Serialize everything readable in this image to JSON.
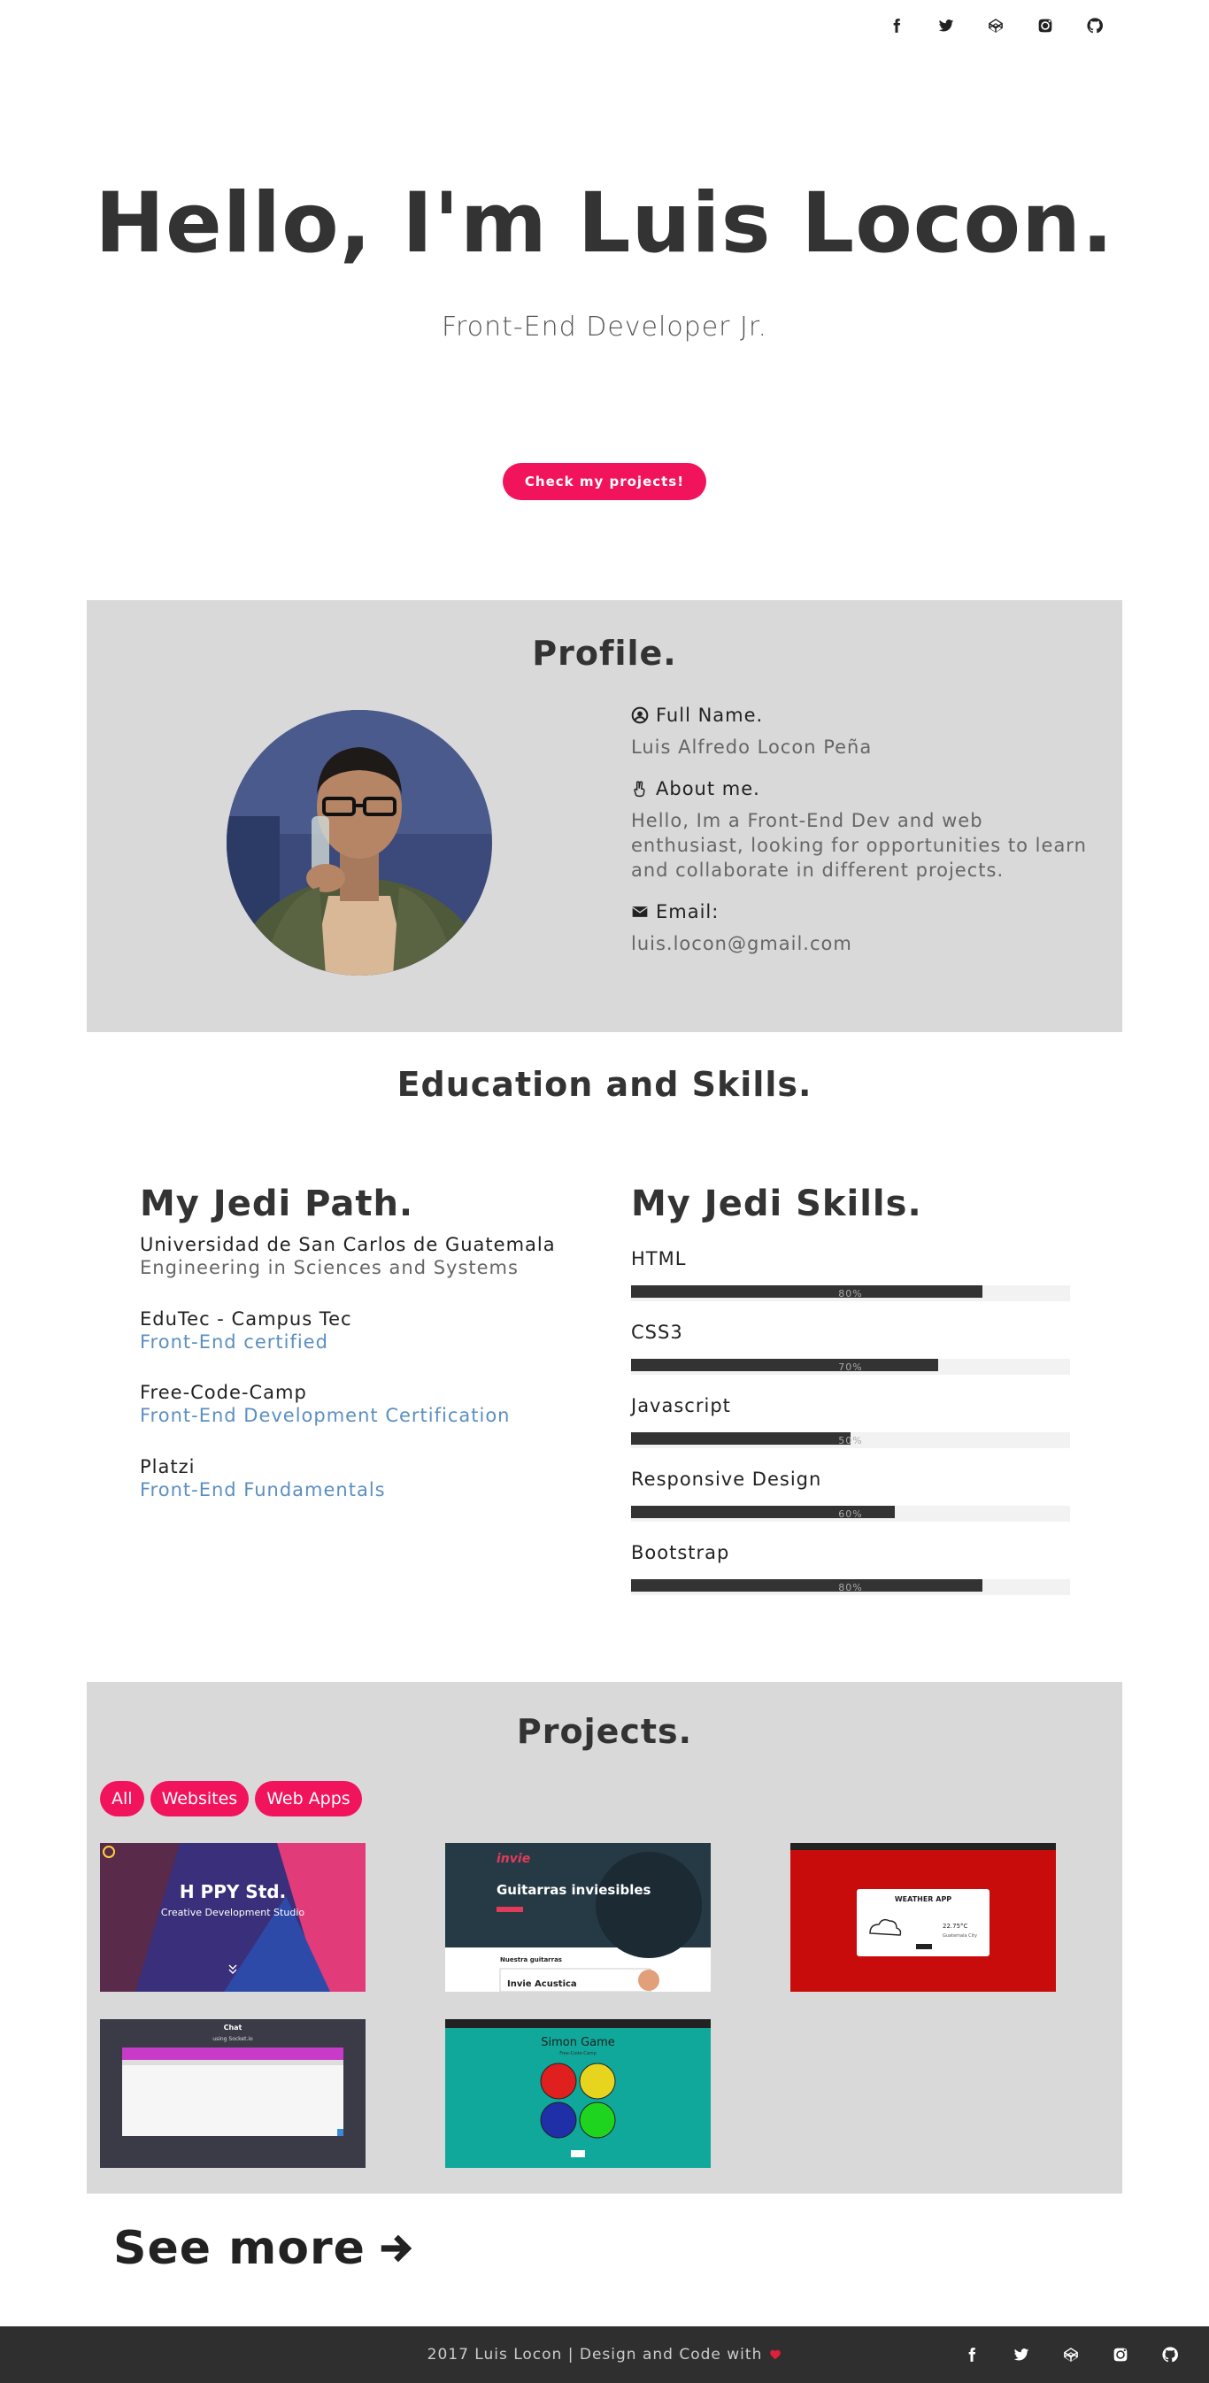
{
  "header": {
    "social": [
      {
        "icon": "facebook-icon"
      },
      {
        "icon": "twitter-icon"
      },
      {
        "icon": "codepen-icon"
      },
      {
        "icon": "instagram-icon"
      },
      {
        "icon": "github-icon"
      }
    ]
  },
  "hero": {
    "title": "Hello, I'm Luis Locon.",
    "subtitle": "Front-End Developer Jr.",
    "cta_label": "Check my projects!"
  },
  "profile": {
    "title": "Profile.",
    "fullname_label": "Full Name.",
    "fullname_value": "Luis Alfredo Locon Peña",
    "about_label": "About me.",
    "about_value": "Hello, Im a Front-End Dev and web enthusiast, looking for opportunities to learn and collaborate in different projects.",
    "email_label": "Email:",
    "email_value": "luis.locon@gmail.com"
  },
  "education": {
    "title": "Education and Skills.",
    "path_title": "My Jedi Path.",
    "skills_title": "My Jedi Skills.",
    "path": [
      {
        "name": "Universidad de San Carlos de Guatemala",
        "detail": "Engineering in Sciences and Systems"
      },
      {
        "name": "EduTec - Campus Tec",
        "detail": "Front-End certified"
      },
      {
        "name": "Free-Code-Camp",
        "detail": "Front-End Development Certification"
      },
      {
        "name": "Platzi",
        "detail": "Front-End Fundamentals"
      }
    ],
    "skills": [
      {
        "name": "HTML",
        "percent": 80,
        "label": "80%"
      },
      {
        "name": "CSS3",
        "percent": 70,
        "label": "70%"
      },
      {
        "name": "Javascript",
        "percent": 50,
        "label": "50%"
      },
      {
        "name": "Responsive Design",
        "percent": 60,
        "label": "60%"
      },
      {
        "name": "Bootstrap",
        "percent": 80,
        "label": "80%"
      }
    ]
  },
  "projects": {
    "title": "Projects.",
    "filters": [
      "All",
      "Websites",
      "Web Apps"
    ],
    "happy": {
      "brand": "H  PPY Std.",
      "tagline": "Creative Development Studio"
    },
    "invie": {
      "logo": "invie",
      "headline": "Guitarras inviesibles",
      "section": "Nuestra guitarras",
      "card": "Invie Acustica"
    },
    "weather": {
      "title": "WEATHER APP",
      "temp": "22.75°C",
      "place": "Guatemala City"
    },
    "chat": {
      "title": "Chat",
      "subtitle": "using Socket.io"
    },
    "simon": {
      "title": "Simon Game",
      "subtitle": "Free-Code-Camp"
    }
  },
  "see_more": "See more",
  "footer": {
    "text": "2017 Luis Locon | Design and Code with"
  },
  "colors": {
    "accent": "#f2135d",
    "link": "#5b8fc2",
    "section_bg": "#d9d9d9",
    "footer_bg": "#2f2f2f"
  }
}
